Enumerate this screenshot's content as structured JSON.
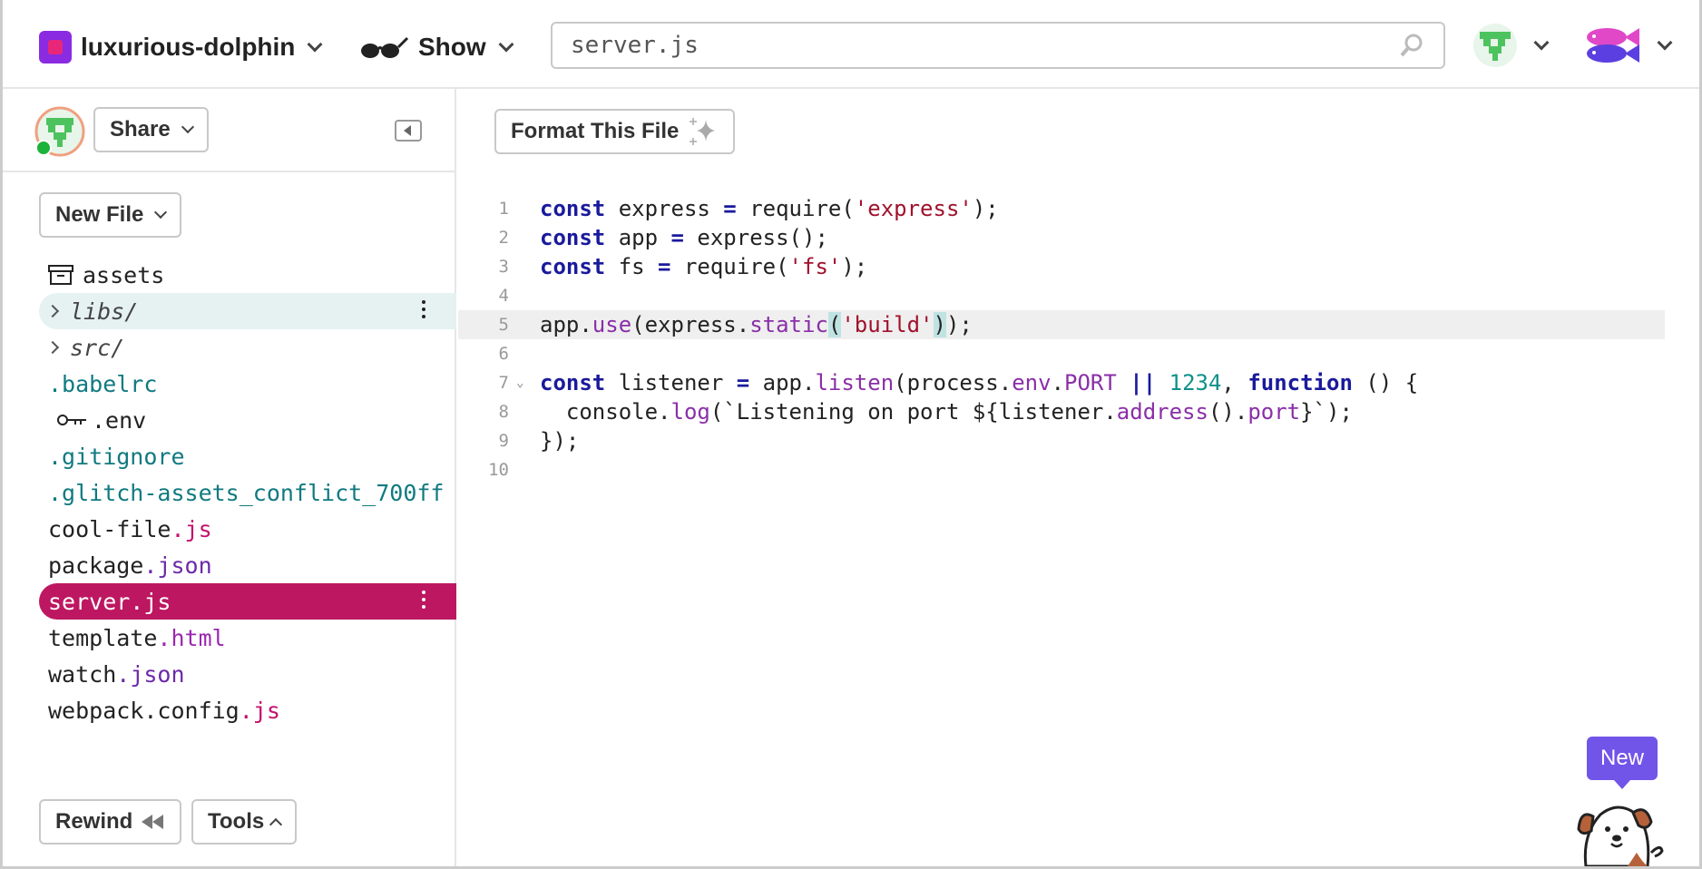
{
  "header": {
    "project_name": "luxurious-dolphin",
    "show_label": "Show",
    "search_value": "server.js"
  },
  "sidebar": {
    "share_label": "Share",
    "new_file_label": "New File",
    "rewind_label": "Rewind",
    "tools_label": "Tools",
    "files": [
      {
        "name": "assets"
      },
      {
        "name": "libs/"
      },
      {
        "name": "src/"
      },
      {
        "name": ".babelrc"
      },
      {
        "name": ".env"
      },
      {
        "name": ".gitignore"
      },
      {
        "name": ".glitch-assets_conflict_700ff"
      },
      {
        "base": "cool-file",
        "ext": ".js"
      },
      {
        "base": "package",
        "ext": ".json"
      },
      {
        "name": "server.js"
      },
      {
        "base": "template",
        "ext": ".html"
      },
      {
        "base": "watch",
        "ext": ".json"
      },
      {
        "base": "webpack.config",
        "ext": ".js"
      }
    ]
  },
  "editor": {
    "format_label": "Format This File",
    "line_numbers": [
      "1",
      "2",
      "3",
      "4",
      "5",
      "6",
      "7",
      "8",
      "9",
      "10"
    ],
    "code": {
      "l1": {
        "a": "const",
        "b": " express ",
        "c": "=",
        "d": " require(",
        "e": "'express'",
        "f": ");"
      },
      "l2": {
        "a": "const",
        "b": " app ",
        "c": "=",
        "d": " express();"
      },
      "l3": {
        "a": "const",
        "b": " fs ",
        "c": "=",
        "d": " require(",
        "e": "'fs'",
        "f": ");"
      },
      "l5": {
        "a": "app.",
        "b": "use",
        "c": "(express.",
        "d": "static",
        "e": "(",
        "f": "'build'",
        "g": ")",
        "h": ");"
      },
      "l7": {
        "a": "const",
        "b": " listener ",
        "c": "=",
        "d": " app.",
        "e": "listen",
        "f": "(process.",
        "g": "env",
        "h": ".",
        "i": "PORT",
        "j": " ",
        "k": "||",
        "l": " ",
        "m": "1234",
        "n": ", ",
        "o": "function",
        "p": " () {"
      },
      "l8": {
        "a": "  console.",
        "b": "log",
        "c": "(`Listening on port ${listener.",
        "d": "address",
        "e": "().",
        "f": "port",
        "g": "}`);"
      },
      "l9": {
        "a": "});"
      }
    }
  },
  "badge": {
    "new_label": "New"
  }
}
